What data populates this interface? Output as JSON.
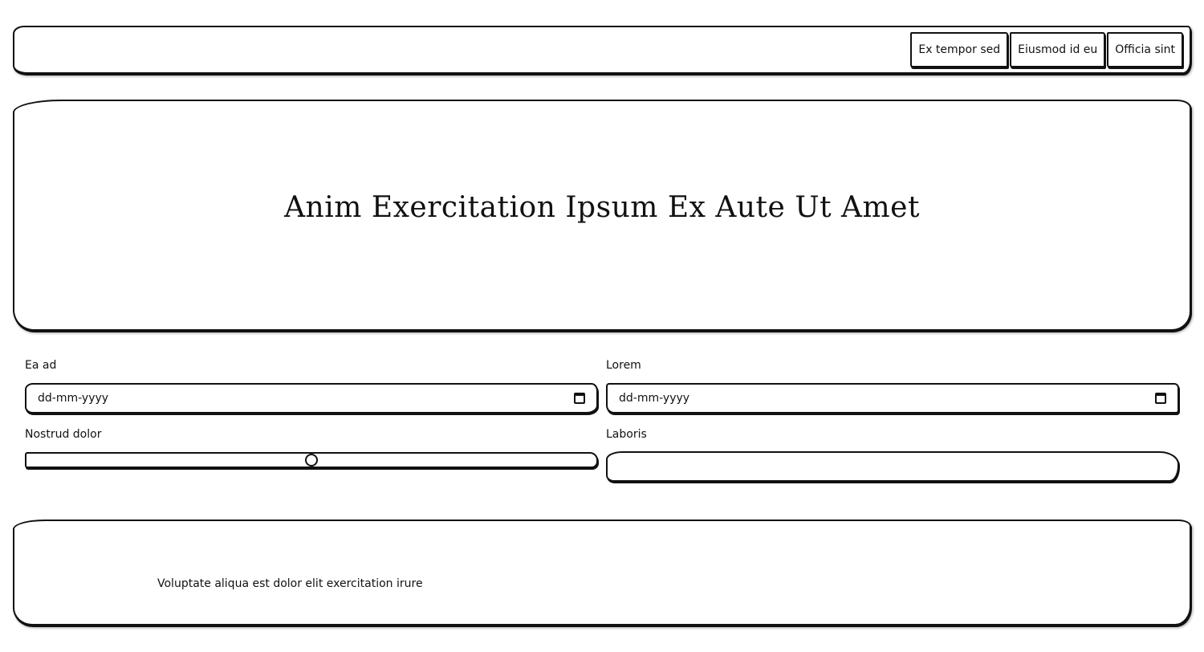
{
  "nav": {
    "items": [
      {
        "label": "Ex tempor sed"
      },
      {
        "label": "Eiusmod id eu"
      },
      {
        "label": "Officia sint"
      }
    ]
  },
  "hero": {
    "title": "Anim Exercitation Ipsum Ex Aute Ut Amet"
  },
  "form": {
    "date_left": {
      "label": "Ea ad",
      "placeholder": "dd-mm-yyyy"
    },
    "date_right": {
      "label": "Lorem",
      "placeholder": "dd-mm-yyyy"
    },
    "range": {
      "label": "Nostrud dolor",
      "value_fraction": 0.5
    },
    "text": {
      "label": "Laboris",
      "value": ""
    }
  },
  "footer": {
    "text": "Voluptate aliqua est dolor elit exercitation irure"
  },
  "icons": {
    "calendar": "calendar-icon"
  }
}
